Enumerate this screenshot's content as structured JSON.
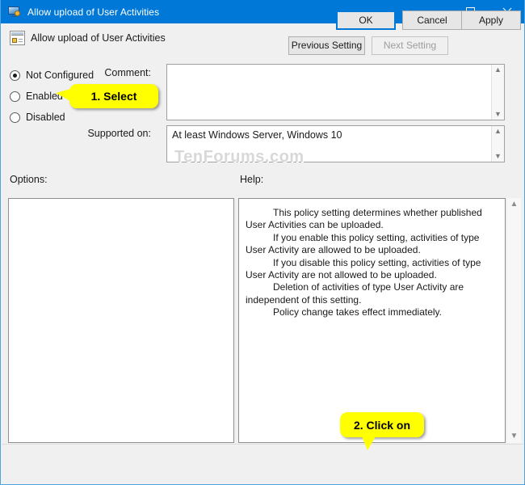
{
  "window": {
    "title": "Allow upload of User Activities",
    "icon": "monitor-policy-icon",
    "controls": {
      "minimize": "minimize-icon",
      "maximize": "maximize-icon",
      "close": "close-icon"
    },
    "accent_color": "#0078d7",
    "border_color": "#4ea3e0"
  },
  "header": {
    "icon": "policy-setting-icon",
    "title": "Allow upload of User Activities",
    "previous_setting": "Previous Setting",
    "next_setting": "Next Setting",
    "next_setting_disabled": true
  },
  "state": {
    "options": [
      {
        "label": "Not Configured",
        "selected": true
      },
      {
        "label": "Enabled",
        "selected": false
      },
      {
        "label": "Disabled",
        "selected": false
      }
    ]
  },
  "comment": {
    "label": "Comment:",
    "value": "",
    "scroll_up": "scroll-up-icon",
    "scroll_down": "scroll-down-icon"
  },
  "supported": {
    "label": "Supported on:",
    "value": "At least Windows Server, Windows 10",
    "scroll_up": "scroll-up-icon",
    "scroll_down": "scroll-down-icon"
  },
  "panels": {
    "options_label": "Options:",
    "help_label": "Help:",
    "options_content": "",
    "help_paragraphs": [
      "This policy setting determines whether published User Activities can be uploaded.",
      "If you enable this policy setting, activities of type User Activity are allowed to be uploaded.",
      "If you disable this policy setting, activities of type User Activity are not allowed to be uploaded.",
      "Deletion of activities of type User Activity are independent of this setting.",
      "Policy change takes effect immediately."
    ]
  },
  "footer": {
    "ok": "OK",
    "cancel": "Cancel",
    "apply": "Apply"
  },
  "watermark": "TenForums.com",
  "callouts": [
    {
      "text": "1. Select",
      "points_to": "enabled-radio"
    },
    {
      "text": "2. Click on",
      "points_to": "ok-button"
    }
  ]
}
